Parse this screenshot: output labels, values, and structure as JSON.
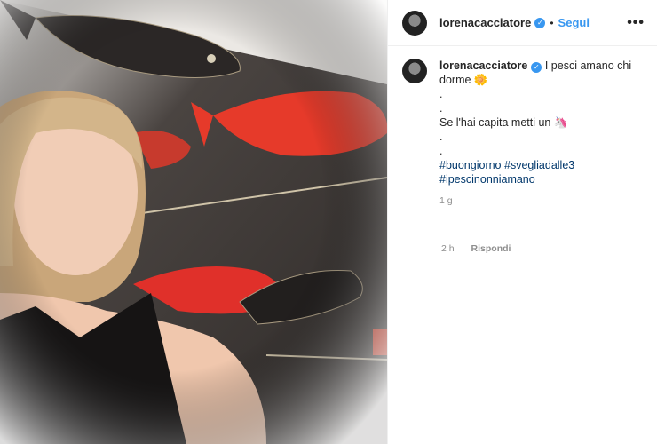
{
  "post": {
    "username": "lorenacacciatore",
    "follow_label": "Segui",
    "more_icon": "more-options-icon",
    "caption_line1": "I pesci amano chi",
    "caption_line2": "dorme",
    "caption_emoji": "🌼",
    "dot1": ".",
    "dot2": ".",
    "caption_line3": "Se l'hai capita metti un",
    "caption_emoji2": "🦄",
    "dot3": ".",
    "dot4": ".",
    "hashtag1": "#buongiorno",
    "hashtag2": "#svegliadalle3",
    "hashtag3": "#ipescinonniamano",
    "caption_time": "1 g",
    "reply_time": "2 h",
    "reply_label": "Rispondi"
  },
  "colors": {
    "link_blue": "#3897f0",
    "hashtag": "#00376b",
    "meta_gray": "#8e8e8e"
  }
}
